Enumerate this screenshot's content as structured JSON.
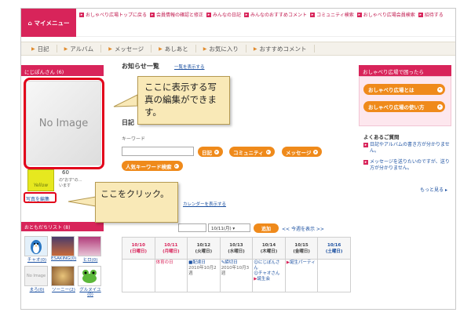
{
  "header": {
    "mymenu": "マイメニュー",
    "links": [
      "おしゃべり広場トップに戻る",
      "会員情報の確認と修正",
      "みんなの日記",
      "みんなのおすすめコメント",
      "コミュニティ検索",
      "おしゃべり広場会員検索",
      "招待する"
    ]
  },
  "nav": [
    "日記",
    "アルバム",
    "メッセージ",
    "あしあと",
    "お気に入り",
    "おすすめコメント"
  ],
  "left": {
    "user_title": "にじぽんさん (6)",
    "noimage": "No Image",
    "badge": "Yellow",
    "count": "60",
    "ministat": [
      "の\"おす\"の…",
      "います"
    ],
    "photo_edit": "写真を編集",
    "friends_title": "おともだちリスト (8)",
    "friends": [
      {
        "name": "チャオ(0)",
        "img": "penguin"
      },
      {
        "name": "ESAKING(0)",
        "img": "photo"
      },
      {
        "name": "ヒロ(0)",
        "img": "photo"
      },
      {
        "name": "まろ(0)",
        "img": "No Image"
      },
      {
        "name": "ソーニー(2)",
        "img": "photo"
      },
      {
        "name": "グルヌイユ(0)",
        "img": "frog"
      }
    ]
  },
  "center": {
    "notice_title": "お知らせ一覧",
    "notice_link": "一覧を表示する",
    "diary_title": "日記",
    "keyword_label": "キーワード",
    "buttons": [
      "日記",
      "コミュニティ",
      "メッセージ"
    ],
    "popular_btn": "人気キーワード検索",
    "calendar_link": "カレンダーを表示する",
    "month_select": "10/11(月)",
    "add_btn": "追加",
    "today_link": "<< 今週を表示 >>",
    "days": [
      {
        "date": "10/10",
        "dow": "(日曜日)",
        "type": "sun"
      },
      {
        "date": "10/11",
        "dow": "(月曜日)",
        "type": "sun"
      },
      {
        "date": "10/12",
        "dow": "(火曜日)",
        "type": ""
      },
      {
        "date": "10/13",
        "dow": "(水曜日)",
        "type": ""
      },
      {
        "date": "10/14",
        "dow": "(木曜日)",
        "type": ""
      },
      {
        "date": "10/15",
        "dow": "(金曜日)",
        "type": ""
      },
      {
        "date": "10/16",
        "dow": "(土曜日)",
        "type": "sat"
      }
    ],
    "events": [
      [],
      [
        {
          "t": "体育の日",
          "red": true
        }
      ],
      [
        {
          "t": "配達日",
          "red": false
        },
        {
          "t": "2010年10月2週",
          "red": false
        }
      ],
      [
        {
          "t": "締切日",
          "red": false
        },
        {
          "t": "2010年10月3週",
          "red": false
        }
      ],
      [
        {
          "t": "にじぽんさん",
          "red": false
        },
        {
          "t": "チャオさん",
          "red": false
        },
        {
          "t": "誕生会",
          "red": false
        }
      ],
      [
        {
          "t": "誕生パーティ",
          "red": false
        }
      ],
      []
    ]
  },
  "right": {
    "title": "おしゃべり広場で困ったら",
    "pills": [
      "おしゃべり広場とは",
      "おしゃべり広場の使い方"
    ],
    "faq_title": "よくあるご質問",
    "faqs": [
      "日記やアルバムの書き方が分かりません。",
      "メッセージを送りたいのですが、送り方が分かりません。"
    ],
    "more": "もっと見る"
  },
  "callouts": {
    "top": "ここに表示する写真の編集ができます。",
    "bottom": "ここをクリック。"
  },
  "colors": {
    "accent": "#d8245a",
    "button": "#ef8a1b",
    "highlight": "#e2001a"
  }
}
